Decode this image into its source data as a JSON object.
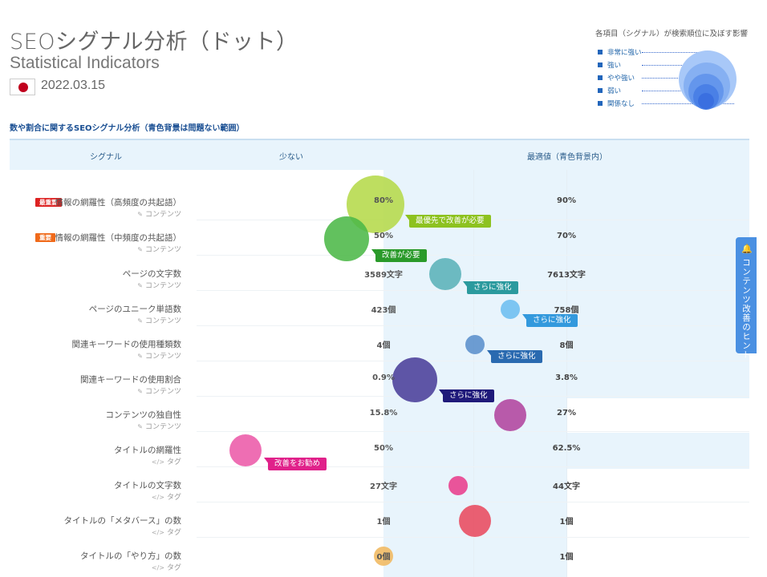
{
  "header": {
    "title": "SEOシグナル分析（ドット）",
    "subtitle": "Statistical Indicators",
    "date": "2022.03.15"
  },
  "legend": {
    "title": "各項目（シグナル）が検索順位に及ぼす影響",
    "items": [
      "非常に強い",
      "強い",
      "やや強い",
      "弱い",
      "関係なし"
    ]
  },
  "section_heading": "数や割合に関するSEOシグナル分析（青色背景は問題ない範囲）",
  "columns": {
    "signal": "シグナル",
    "low": "少ない",
    "optimal": "最適値（青色背景内）"
  },
  "rows": [
    {
      "badge": "最重要",
      "badge_color": "#dd2222",
      "name": "情報の網羅性（高頻度の共起語）",
      "category": "コンテンツ",
      "icon": "edit-icon",
      "low_value": "80%",
      "optimal_value": "90%",
      "bubble_color": "#b5d94a",
      "callout": "最優先で改善が必要",
      "callout_color": "#8dc21f"
    },
    {
      "badge": "重要",
      "badge_color": "#f06a1a",
      "name": "情報の網羅性（中頻度の共起語）",
      "category": "コンテンツ",
      "icon": "edit-icon",
      "low_value": "50%",
      "optimal_value": "70%",
      "bubble_color": "#4cb848",
      "callout": "改善が必要",
      "callout_color": "#2a9a2a"
    },
    {
      "badge": "",
      "name": "ページの文字数",
      "category": "コンテンツ",
      "icon": "edit-icon",
      "low_value": "3589文字",
      "optimal_value": "7613文字",
      "bubble_color": "#5ab2b8",
      "callout": "さらに強化",
      "callout_color": "#2b9a9e"
    },
    {
      "badge": "",
      "name": "ページのユニーク単語数",
      "category": "コンテンツ",
      "icon": "edit-icon",
      "low_value": "423個",
      "optimal_value": "758個",
      "bubble_color": "#6cbef0",
      "callout": "さらに強化",
      "callout_color": "#3399dd"
    },
    {
      "badge": "",
      "name": "関連キーワードの使用種類数",
      "category": "コンテンツ",
      "icon": "edit-icon",
      "low_value": "4個",
      "optimal_value": "8個",
      "bubble_color": "#5a8fcc",
      "callout": "さらに強化",
      "callout_color": "#2a6ab0"
    },
    {
      "badge": "",
      "name": "関連キーワードの使用割合",
      "category": "コンテンツ",
      "icon": "edit-icon",
      "low_value": "0.9%",
      "optimal_value": "3.8%",
      "bubble_color": "#4a3f9a",
      "callout": "さらに強化",
      "callout_color": "#1f1a7a"
    },
    {
      "badge": "",
      "name": "コンテンツの独自性",
      "category": "コンテンツ",
      "icon": "edit-icon",
      "low_value": "15.8%",
      "optimal_value": "27%",
      "bubble_color": "#b0449e",
      "callout": "",
      "callout_color": ""
    },
    {
      "badge": "",
      "name": "タイトルの網羅性",
      "category": "タグ",
      "icon": "code-icon",
      "low_value": "50%",
      "optimal_value": "62.5%",
      "bubble_color": "#ec5aa8",
      "callout": "改善をお勧め",
      "callout_color": "#e0218a"
    },
    {
      "badge": "",
      "name": "タイトルの文字数",
      "category": "タグ",
      "icon": "code-icon",
      "low_value": "27文字",
      "optimal_value": "44文字",
      "bubble_color": "#e83e8c",
      "callout": "",
      "callout_color": ""
    },
    {
      "badge": "",
      "name": "タイトルの「メタバース」の数",
      "category": "タグ",
      "icon": "code-icon",
      "low_value": "1個",
      "optimal_value": "1個",
      "bubble_color": "#e84a5f",
      "callout": "",
      "callout_color": ""
    },
    {
      "badge": "",
      "name": "タイトルの「やり方」の数",
      "category": "タグ",
      "icon": "code-icon",
      "low_value": "0個",
      "optimal_value": "1個",
      "bubble_color": "#f0b860",
      "callout": "",
      "callout_color": ""
    }
  ],
  "hint_tab": {
    "label": "コンテンツ改善のヒント",
    "icon": "bell-icon"
  }
}
